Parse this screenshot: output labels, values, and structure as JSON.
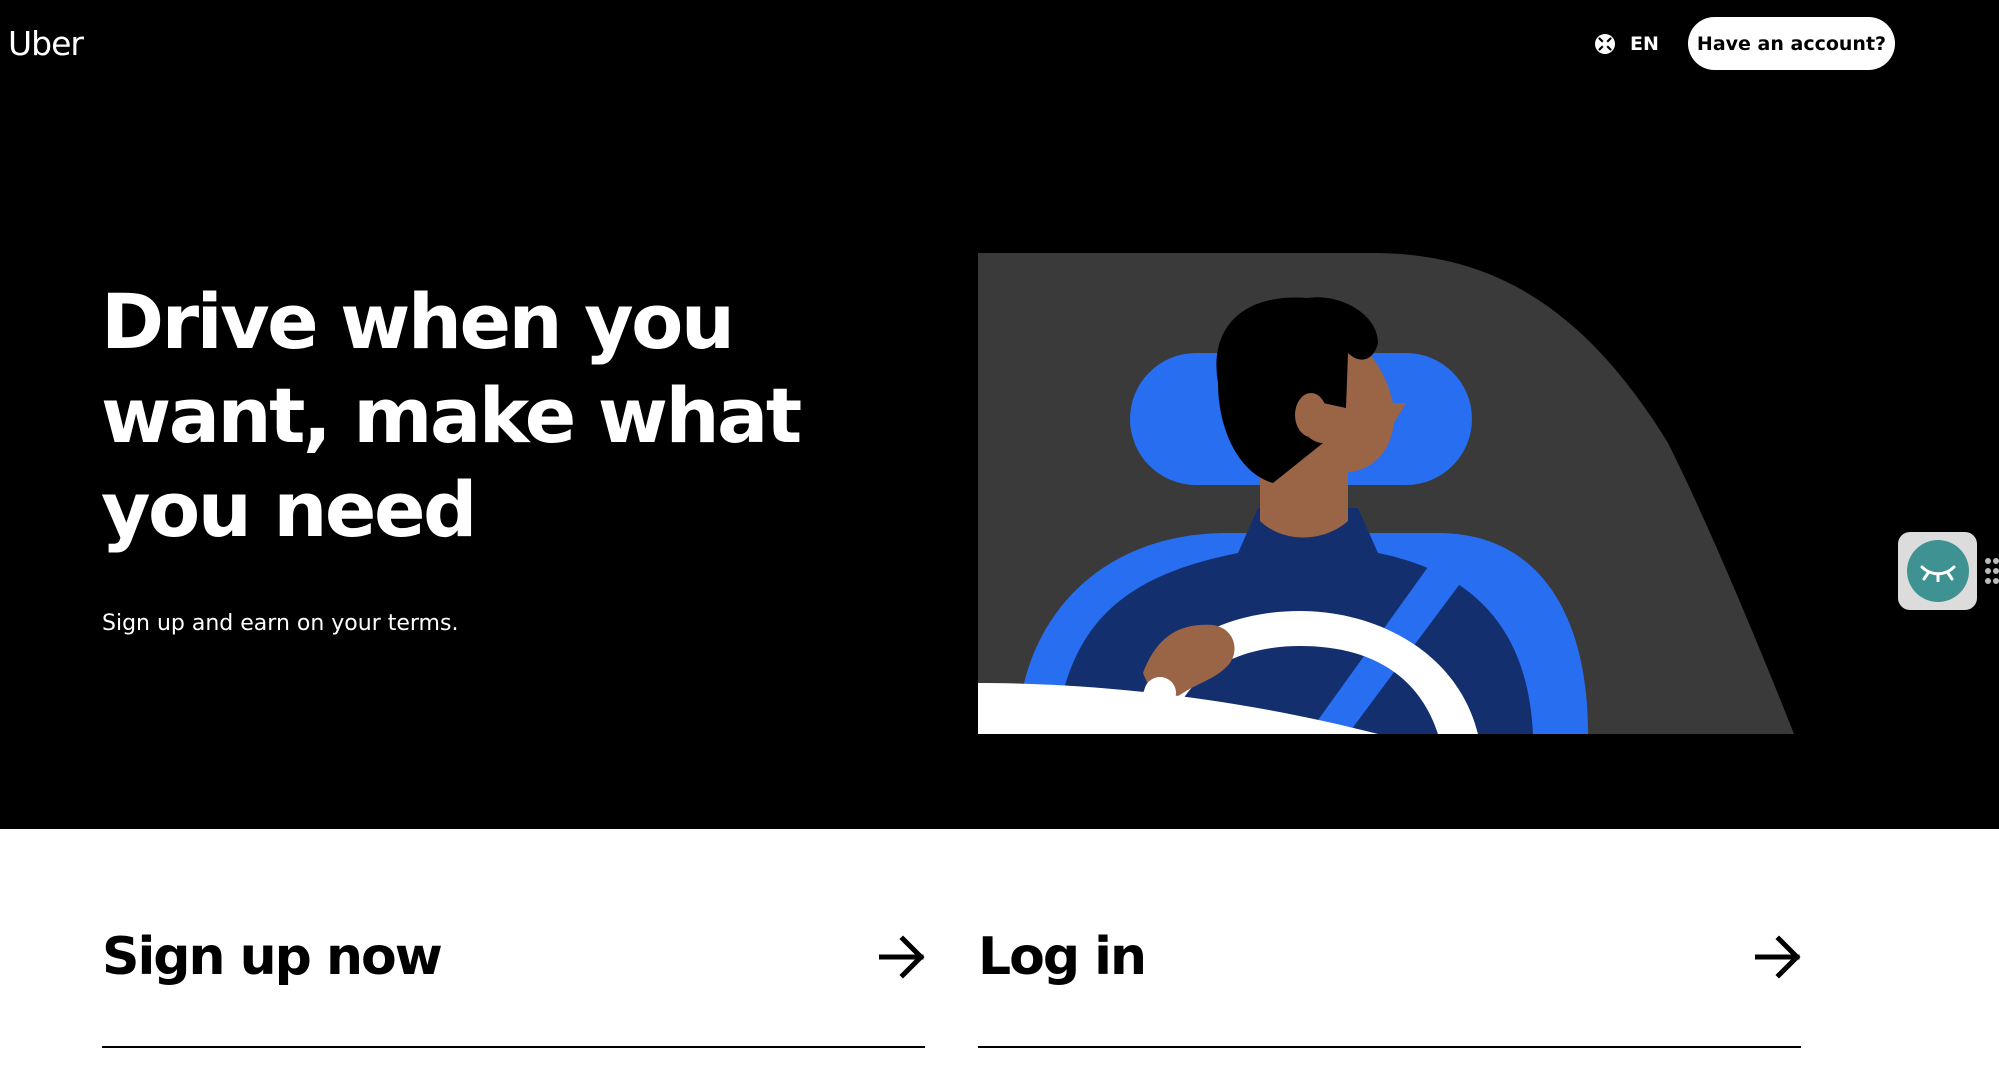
{
  "header": {
    "logo_text": "Uber",
    "language": {
      "icon": "globe-icon",
      "code": "EN"
    },
    "account_button": "Have an account?"
  },
  "hero": {
    "headline": "Drive when you want, make what you need",
    "subline": "Sign up and earn on your terms.",
    "illustration": "driver-at-steering-wheel-illustration"
  },
  "actions": {
    "signup": {
      "label": "Sign up now",
      "icon": "arrow-right-icon"
    },
    "login": {
      "label": "Log in",
      "icon": "arrow-right-icon"
    }
  },
  "widget": {
    "icon": "closed-eye-icon",
    "handle_icon": "drag-handle-icon"
  },
  "colors": {
    "hero_background": "#000000",
    "page_background": "#ffffff",
    "illustration_dark": "#3a3a3a",
    "seat_blue": "#276ef1",
    "shirt_navy": "#142f6e",
    "skin": "#9a6447",
    "widget_teal": "#3f9292"
  }
}
